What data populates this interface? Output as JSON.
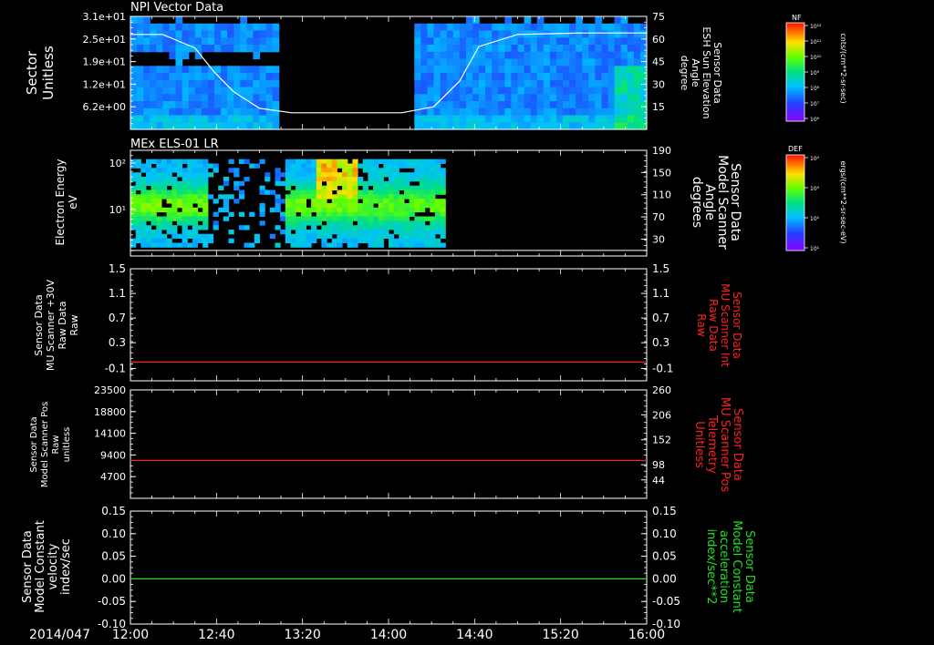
{
  "chart_data": [
    {
      "type": "heatmap",
      "title": "NPI Vector Data",
      "ylabel": [
        "Sector",
        "Unitless"
      ],
      "y_ticks": [
        "3.1e+01",
        "2.5e+01",
        "1.9e+01",
        "1.2e+01",
        "6.2e+00"
      ],
      "y2label": [
        "Sensor Data",
        "ESH Sun Elevation",
        "Angle",
        "degree"
      ],
      "y2_ticks": [
        "75",
        "60",
        "45",
        "30",
        "15"
      ],
      "y2lim": [
        0,
        75
      ],
      "line_series": {
        "color": "#ffffff",
        "hours": [
          0,
          0.25,
          0.5,
          0.65,
          0.8,
          1.0,
          1.25,
          1.55,
          1.85,
          2.1,
          2.35,
          2.55,
          2.7,
          3.0,
          3.5,
          4.0
        ],
        "values": [
          63,
          63,
          54,
          38,
          25,
          14,
          11,
          11,
          11,
          11,
          15,
          32,
          55,
          63,
          64,
          64
        ]
      },
      "colorbar": {
        "label": "NF",
        "units": "cnts/(cm**2-sr-sec)",
        "ticks": [
          "10¹²",
          "10¹¹",
          "10¹⁰",
          "10⁹",
          "10⁸",
          "10⁷",
          "10⁶"
        ]
      }
    },
    {
      "type": "heatmap",
      "title": "MEx ELS-01 LR",
      "ylabel": [
        "Electron Energy",
        "eV"
      ],
      "y_ticks": [
        "10²",
        "10¹"
      ],
      "y2label": [
        "Sensor Data",
        "Model Scanner",
        "Angle",
        "degrees"
      ],
      "y2_ticks": [
        "190",
        "150",
        "110",
        "70",
        "30"
      ],
      "y2lim": [
        0,
        190
      ],
      "line_series": {
        "color": "#ffffff",
        "hours": [
          0,
          4
        ],
        "values": [
          10,
          10
        ]
      },
      "colorbar": {
        "label": "DEF",
        "units": "ergs/(cm**2-sr-sec-eV)",
        "ticks": [
          "10⁴",
          "10³",
          "10²",
          "10¹"
        ]
      }
    },
    {
      "type": "line",
      "ylabel": [
        "Sensor Data",
        "MU Scanner +30V",
        "Raw Data",
        "Raw"
      ],
      "y_ticks": [
        "1.5",
        "1.1",
        "0.7",
        "0.3",
        "-0.1"
      ],
      "ylim": [
        -0.3,
        1.5
      ],
      "y2label": [
        "Sensor Data",
        "MU Scanner Int",
        "Raw Data",
        "Raw"
      ],
      "y2_ticks": [
        "1.5",
        "1.1",
        "0.7",
        "0.3",
        "-0.1"
      ],
      "series": [
        {
          "color": "#ff2020",
          "hours": [
            0,
            4
          ],
          "values": [
            0,
            0
          ]
        }
      ]
    },
    {
      "type": "line",
      "ylabel": [
        "Sensor Data",
        "Model Scanner Pos",
        "Raw",
        "unitless"
      ],
      "y_ticks": [
        "23500",
        "18800",
        "14100",
        "9400",
        "4700"
      ],
      "ylim": [
        0,
        23500
      ],
      "y2label": [
        "Sensor Data",
        "MU Scanner Pos",
        "Telemetry",
        "Unitless"
      ],
      "y2_ticks": [
        "260",
        "206",
        "152",
        "98",
        "44"
      ],
      "series": [
        {
          "color": "#ff2020",
          "hours": [
            0,
            4
          ],
          "values": [
            8200,
            8200
          ]
        }
      ]
    },
    {
      "type": "line",
      "ylabel": [
        "Sensor Data",
        "Model Constant",
        "velocity",
        "index/sec"
      ],
      "y_ticks": [
        "0.15",
        "0.10",
        "0.05",
        "0.00",
        "-0.05",
        "-0.10"
      ],
      "ylim": [
        -0.1,
        0.15
      ],
      "y2label": [
        "Sensor Data",
        "Model Constant",
        "acceleration",
        "index/sec**2"
      ],
      "y2_ticks": [
        "0.15",
        "0.10",
        "0.05",
        "0.00",
        "-0.05",
        "-0.10"
      ],
      "series": [
        {
          "color": "#20e020",
          "hours": [
            0,
            4
          ],
          "values": [
            0,
            0
          ]
        }
      ]
    }
  ],
  "x_axis": {
    "date_label": "2014/047",
    "tick_labels": [
      "12:00",
      "12:40",
      "13:20",
      "14:00",
      "14:40",
      "15:20",
      "16:00"
    ],
    "tick_hours": [
      0,
      0.6667,
      1.3333,
      2.0,
      2.6667,
      3.3333,
      4.0
    ]
  },
  "colors": {
    "background": "#000000",
    "frame": "#ffffff",
    "label_red": "#ff2020",
    "label_green": "#20e020"
  }
}
